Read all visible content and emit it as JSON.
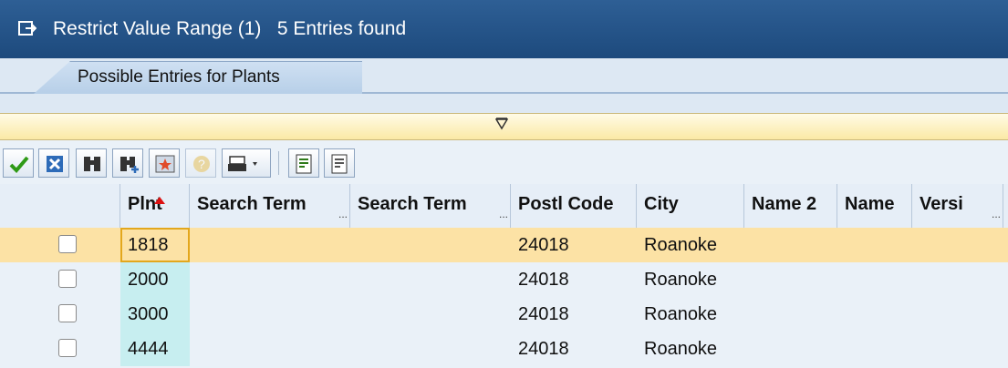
{
  "window": {
    "title": "Restrict Value Range (1)   5 Entries found",
    "title_icon": "restrict-window-icon"
  },
  "tab": {
    "label": "Possible Entries for Plants"
  },
  "filter": {
    "icon": "filter-triangle-icon"
  },
  "toolbar": {
    "buttons": [
      {
        "name": "confirm-button",
        "icon": "checkmark-icon"
      },
      {
        "name": "cancel-button",
        "icon": "x-icon"
      },
      {
        "name": "find-button",
        "icon": "binoculars-icon"
      },
      {
        "name": "find-next-button",
        "icon": "binoculars-plus-icon"
      },
      {
        "name": "new-search-button",
        "icon": "star-icon"
      },
      {
        "name": "help-button",
        "icon": "help-icon"
      },
      {
        "name": "print-button",
        "icon": "printer-icon"
      },
      {
        "name": "export-button",
        "icon": "export-icon"
      },
      {
        "name": "layout-button",
        "icon": "layout-icon"
      }
    ]
  },
  "table": {
    "columns": [
      {
        "label": "Plnt",
        "sorted": "ascending"
      },
      {
        "label": "Search Term",
        "truncated": true
      },
      {
        "label": "Search Term",
        "truncated": true
      },
      {
        "label": "Postl Code"
      },
      {
        "label": "City"
      },
      {
        "label": "Name 2"
      },
      {
        "label": "Name"
      },
      {
        "label": "Versi",
        "truncated": true
      }
    ],
    "rows": [
      {
        "plnt": "1818",
        "postl_code": "24018",
        "city": "Roanoke",
        "selected": true
      },
      {
        "plnt": "2000",
        "postl_code": "24018",
        "city": "Roanoke"
      },
      {
        "plnt": "3000",
        "postl_code": "24018",
        "city": "Roanoke"
      },
      {
        "plnt": "4444",
        "postl_code": "24018",
        "city": "Roanoke"
      }
    ]
  },
  "colors": {
    "title_bar": "#1d4a7d",
    "selection": "#fce2a5",
    "key_column": "#c7eef0",
    "sort_arrow": "#d11"
  }
}
